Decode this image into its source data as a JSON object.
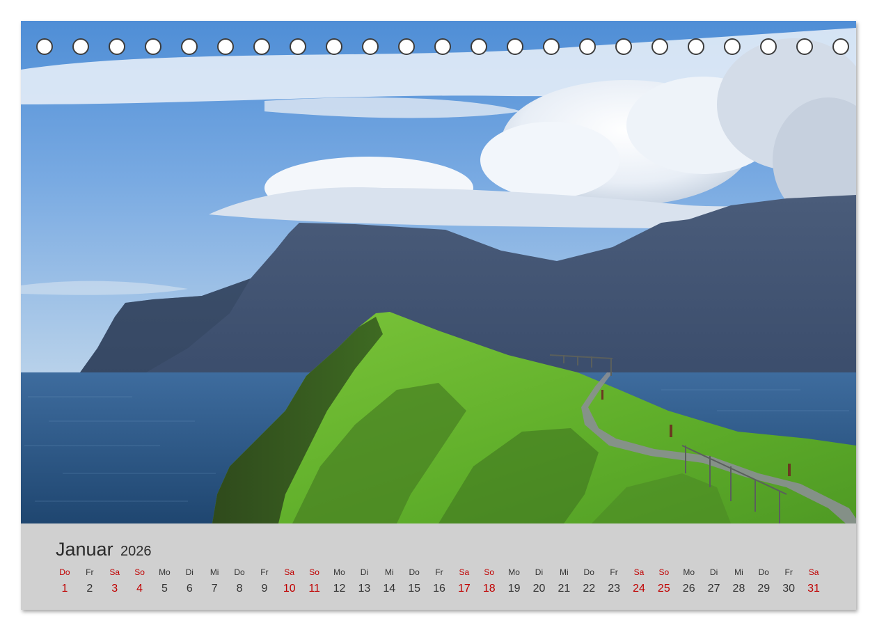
{
  "calendar": {
    "month": "Januar",
    "year": "2026",
    "weekend_color": "#c00000",
    "days": [
      {
        "dow": "Do",
        "num": "1",
        "weekend": true
      },
      {
        "dow": "Fr",
        "num": "2",
        "weekend": false
      },
      {
        "dow": "Sa",
        "num": "3",
        "weekend": true
      },
      {
        "dow": "So",
        "num": "4",
        "weekend": true
      },
      {
        "dow": "Mo",
        "num": "5",
        "weekend": false
      },
      {
        "dow": "Di",
        "num": "6",
        "weekend": false
      },
      {
        "dow": "Mi",
        "num": "7",
        "weekend": false
      },
      {
        "dow": "Do",
        "num": "8",
        "weekend": false
      },
      {
        "dow": "Fr",
        "num": "9",
        "weekend": false
      },
      {
        "dow": "Sa",
        "num": "10",
        "weekend": true
      },
      {
        "dow": "So",
        "num": "11",
        "weekend": true
      },
      {
        "dow": "Mo",
        "num": "12",
        "weekend": false
      },
      {
        "dow": "Di",
        "num": "13",
        "weekend": false
      },
      {
        "dow": "Mi",
        "num": "14",
        "weekend": false
      },
      {
        "dow": "Do",
        "num": "15",
        "weekend": false
      },
      {
        "dow": "Fr",
        "num": "16",
        "weekend": false
      },
      {
        "dow": "Sa",
        "num": "17",
        "weekend": true
      },
      {
        "dow": "So",
        "num": "18",
        "weekend": true
      },
      {
        "dow": "Mo",
        "num": "19",
        "weekend": false
      },
      {
        "dow": "Di",
        "num": "20",
        "weekend": false
      },
      {
        "dow": "Mi",
        "num": "21",
        "weekend": false
      },
      {
        "dow": "Do",
        "num": "22",
        "weekend": false
      },
      {
        "dow": "Fr",
        "num": "23",
        "weekend": false
      },
      {
        "dow": "Sa",
        "num": "24",
        "weekend": true
      },
      {
        "dow": "So",
        "num": "25",
        "weekend": true
      },
      {
        "dow": "Mo",
        "num": "26",
        "weekend": false
      },
      {
        "dow": "Di",
        "num": "27",
        "weekend": false
      },
      {
        "dow": "Mi",
        "num": "28",
        "weekend": false
      },
      {
        "dow": "Do",
        "num": "29",
        "weekend": false
      },
      {
        "dow": "Fr",
        "num": "30",
        "weekend": false
      },
      {
        "dow": "Sa",
        "num": "31",
        "weekend": true
      }
    ]
  },
  "binding": {
    "hole_count": 23
  }
}
